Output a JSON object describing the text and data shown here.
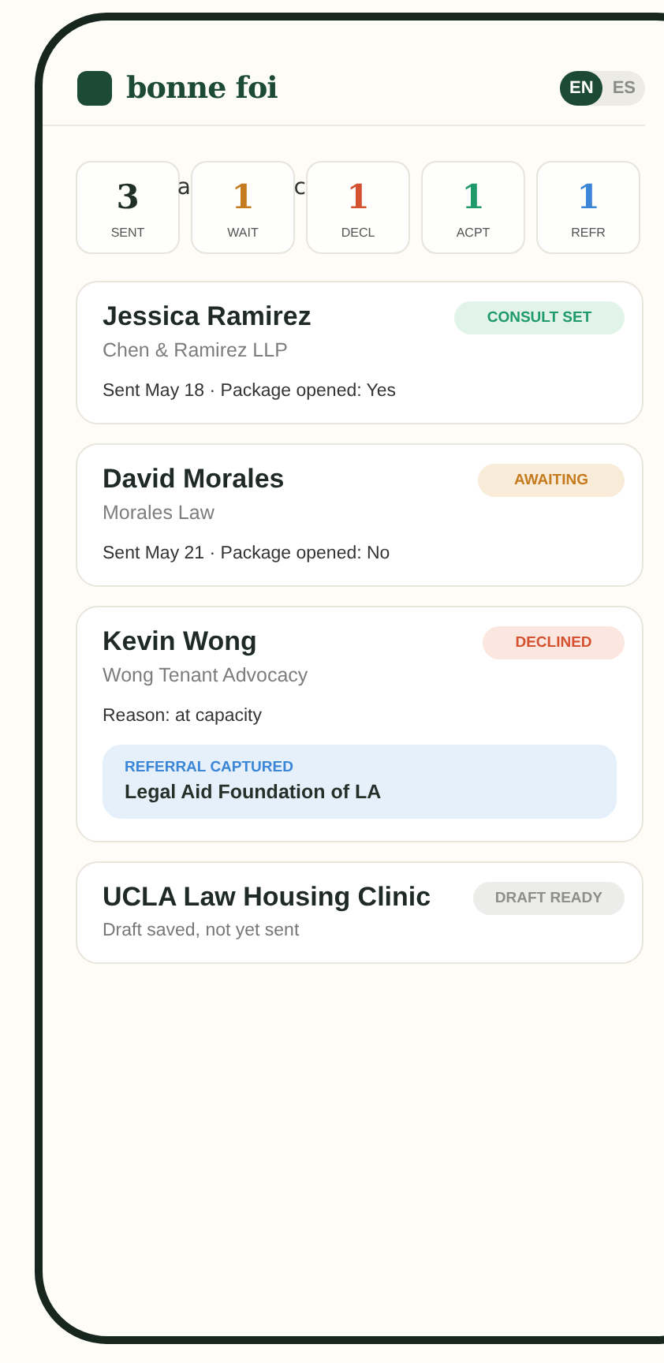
{
  "brand": {
    "name": "bonne foi"
  },
  "languages": [
    {
      "label": "EN",
      "selected": true
    },
    {
      "label": "ES",
      "selected": false
    }
  ],
  "heading_fragments": [
    "a",
    "c"
  ],
  "stats": [
    {
      "value": "3",
      "label": "SENT",
      "color": "#1f2f27"
    },
    {
      "value": "1",
      "label": "WAIT",
      "color": "#c57a1e"
    },
    {
      "value": "1",
      "label": "DECL",
      "color": "#d4522f"
    },
    {
      "value": "1",
      "label": "ACPT",
      "color": "#1f9a6a"
    },
    {
      "value": "1",
      "label": "REFR",
      "color": "#3b86d6"
    }
  ],
  "contacts": [
    {
      "name": "Jessica Ramirez",
      "firm": "Chen & Ramirez LLP",
      "detail": "Sent May 18 · Package opened: Yes",
      "status": {
        "label": "CONSULT SET",
        "kind": "consult"
      }
    },
    {
      "name": "David Morales",
      "firm": "Morales Law",
      "detail": "Sent May 21 · Package opened: No",
      "status": {
        "label": "AWAITING",
        "kind": "awaiting"
      }
    },
    {
      "name": "Kevin Wong",
      "firm": "Wong Tenant Advocacy",
      "detail": "Reason: at capacity",
      "status": {
        "label": "DECLINED",
        "kind": "declined"
      },
      "referral": {
        "label": "REFERRAL CAPTURED",
        "org": "Legal Aid Foundation of LA"
      }
    },
    {
      "name": "UCLA Law Housing Clinic",
      "detail": "Draft saved, not yet sent",
      "status": {
        "label": "DRAFT READY",
        "kind": "draft"
      }
    }
  ]
}
